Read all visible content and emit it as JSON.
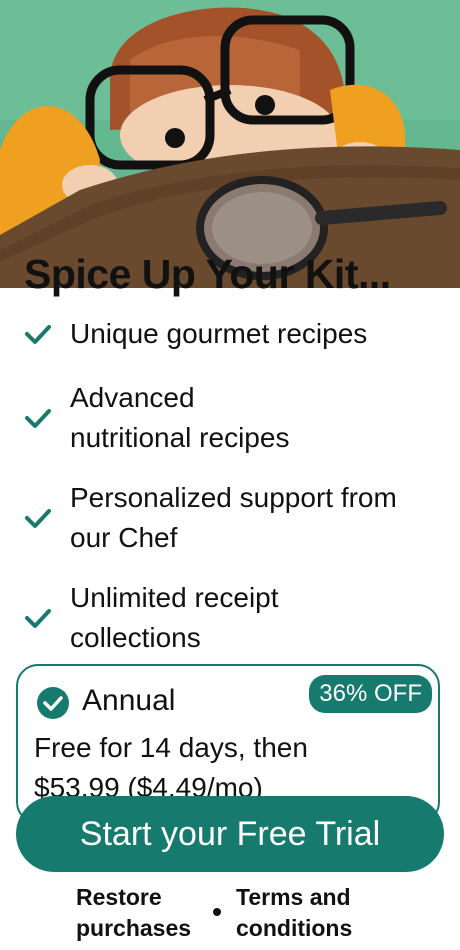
{
  "hero": {
    "title": "Spice Up Your Kit..."
  },
  "features": [
    {
      "line1": "Unique gourmet recipes",
      "line2": ""
    },
    {
      "line1": "Advanced",
      "line2": "nutritional recipes"
    },
    {
      "line1": "Personalized support from",
      "line2": "our Chef"
    },
    {
      "line1": "Unlimited receipt",
      "line2": "collections"
    }
  ],
  "plan": {
    "name": "Annual",
    "badge": "36% OFF",
    "price_line1": "Free for 14 days, then",
    "price_line2": "$53.99 ($4.49/mo)",
    "selected": true
  },
  "cta": {
    "label": "Start your Free Trial"
  },
  "footer": {
    "restore_line1": "Restore",
    "restore_line2": "purchases",
    "terms_line1": "Terms and",
    "terms_line2": "conditions"
  },
  "colors": {
    "accent": "#177a6e",
    "hero_bg": "#5fb98e",
    "table": "#6a4a2e"
  }
}
